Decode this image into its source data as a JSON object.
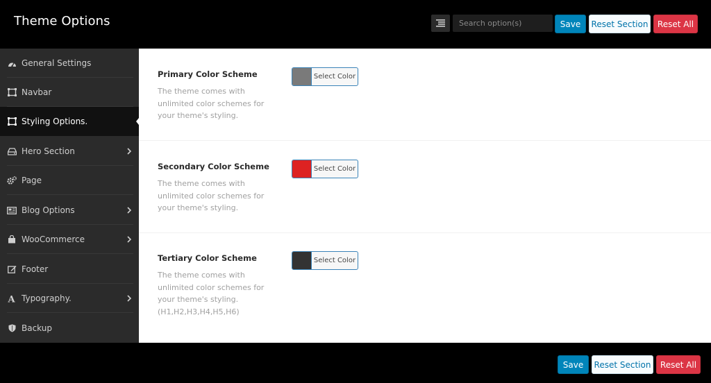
{
  "header": {
    "title": "Theme Options",
    "search_placeholder": "Search option(s)",
    "save_label": "Save",
    "reset_section_label": "Reset Section",
    "reset_all_label": "Reset All"
  },
  "sidebar": {
    "items": [
      {
        "label": "General Settings",
        "icon": "dashboard-icon",
        "has_submenu": false,
        "active": false
      },
      {
        "label": "Navbar",
        "icon": "frame-icon",
        "has_submenu": false,
        "active": false
      },
      {
        "label": "Styling Options.",
        "icon": "frame-icon",
        "has_submenu": false,
        "active": true
      },
      {
        "label": "Hero Section",
        "icon": "hdd-icon",
        "has_submenu": true,
        "active": false
      },
      {
        "label": "Page",
        "icon": "cogs-icon",
        "has_submenu": false,
        "active": false
      },
      {
        "label": "Blog Options",
        "icon": "newspaper-icon",
        "has_submenu": true,
        "active": false
      },
      {
        "label": "WooCommerce",
        "icon": "shopping-bag-icon",
        "has_submenu": true,
        "active": false
      },
      {
        "label": "Footer",
        "icon": "edit-icon",
        "has_submenu": false,
        "active": false
      },
      {
        "label": "Typography.",
        "icon": "font-icon",
        "has_submenu": true,
        "active": false
      },
      {
        "label": "Backup",
        "icon": "shield-icon",
        "has_submenu": false,
        "active": false
      }
    ]
  },
  "main": {
    "options": [
      {
        "title": "Primary Color Scheme",
        "description": "The theme comes with unlimited color schemes for your theme's styling.",
        "button_label": "Select Color",
        "color": "#7a7a7a"
      },
      {
        "title": "Secondary Color Scheme",
        "description": "The theme comes with unlimited color schemes for your theme's styling.",
        "button_label": "Select Color",
        "color": "#dd2222"
      },
      {
        "title": "Tertiary Color Scheme",
        "description": "The theme comes with unlimited color schemes for your theme's styling. (H1,H2,H3,H4,H5,H6)",
        "button_label": "Select Color",
        "color": "#333333"
      }
    ]
  },
  "footer": {
    "save_label": "Save",
    "reset_section_label": "Reset Section",
    "reset_all_label": "Reset All"
  },
  "colors": {
    "accent": "#0085ba",
    "danger": "#dc3545",
    "sidebar_bg": "#2b2b2b",
    "header_bg": "#000000"
  }
}
